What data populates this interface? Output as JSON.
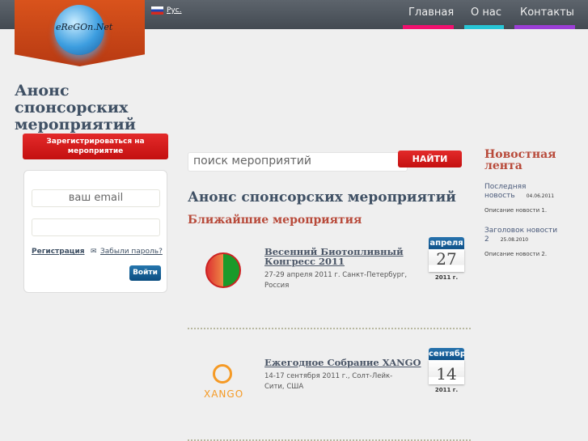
{
  "header": {
    "logo_text": "eReGOn.Net",
    "language": "Рус.",
    "nav": [
      {
        "label": "Главная",
        "color": "#f0106e"
      },
      {
        "label": "О нас",
        "color": "#27c5d5"
      },
      {
        "label": "Контакты",
        "color": "#9b3ed6"
      }
    ]
  },
  "sidebar": {
    "title": "Анонс спонсорских мероприятий",
    "register_button": "Зарегистрироваться на мероприятие",
    "login": {
      "email_placeholder": "ваш email",
      "password_value": "",
      "register_link": "Регистрация",
      "forgot_link": "Забыли пароль?",
      "login_button": "Войти"
    }
  },
  "search": {
    "placeholder": "поиск мероприятий",
    "button": "НАЙТИ"
  },
  "main": {
    "title": "Анонс спонсорских мероприятий",
    "subtitle": "Ближайшие мероприятия",
    "events": [
      {
        "title": "Весенний Биотопливный Конгресс 2011",
        "desc": "27-29 апреля 2011 г. Санкт-Петербург, Россия",
        "month": "апреля",
        "day": "27",
        "year": "2011 г."
      },
      {
        "title": "Ежегодное Собрание XANGO",
        "desc": "14-17 сентября 2011 г., Солт-Лейк-Сити, США",
        "month": "сентябр",
        "day": "14",
        "year": "2011 г.",
        "logo_text": "XANGO"
      }
    ]
  },
  "news": {
    "title": "Новостная лента",
    "items": [
      {
        "title": "Последняя новость",
        "date": "04.06.2011",
        "desc": "Описание новости 1."
      },
      {
        "title": "Заголовок новости 2",
        "date": "25.08.2010",
        "desc": "Описание новости 2."
      }
    ]
  }
}
